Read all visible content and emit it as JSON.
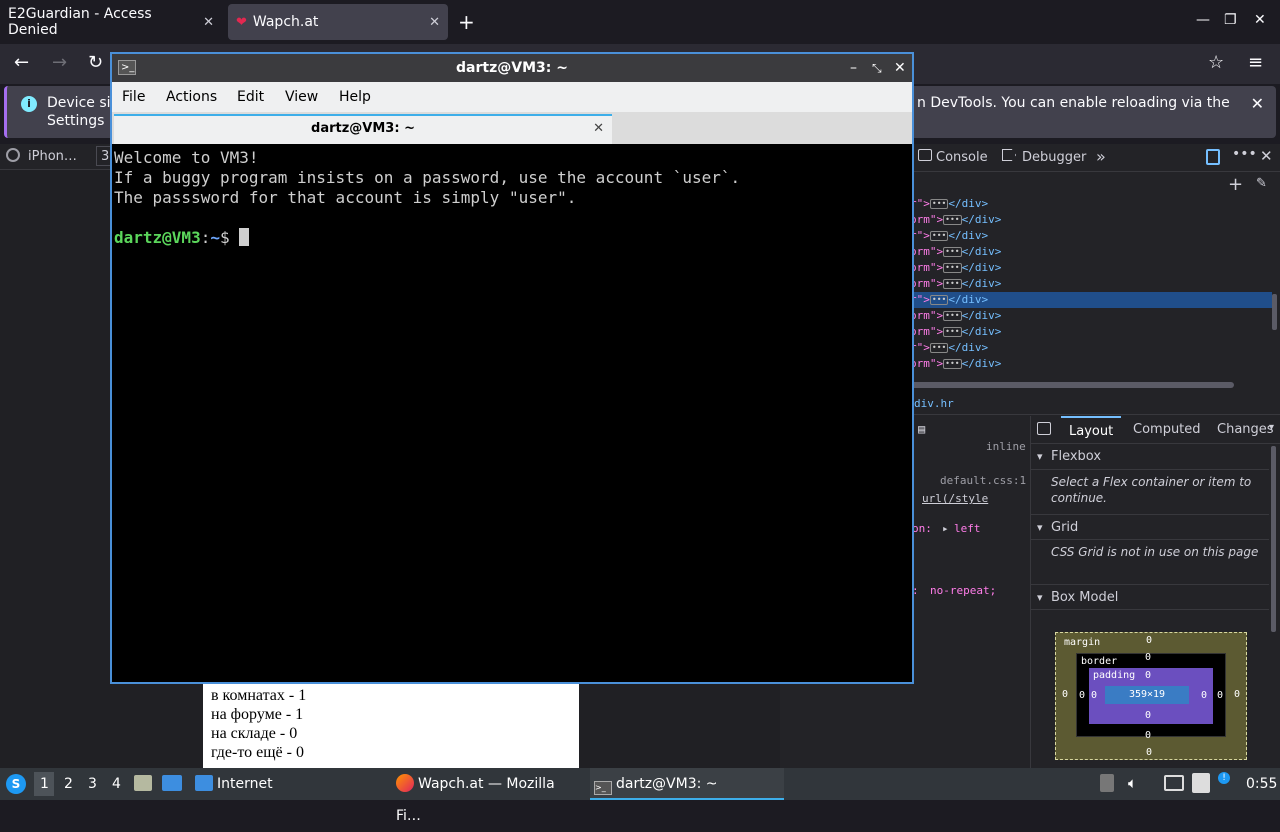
{
  "browser": {
    "tabs": [
      {
        "title": "E2Guardian - Access Denied",
        "close": "✕"
      },
      {
        "title": "Wapch.at",
        "close": "✕"
      }
    ],
    "new_tab": "+",
    "window_controls": {
      "minimize": "—",
      "maximize": "❐",
      "close": "✕"
    },
    "nav": {
      "back": "←",
      "forward": "→",
      "reload": "↻",
      "bookmark": "☆",
      "menu": "≡"
    }
  },
  "infobar": {
    "line1_left": "Device sir",
    "line2_left": "Settings n",
    "line1_right": "n DevTools. You can enable reloading via the",
    "close": "✕"
  },
  "rdm": {
    "device": "iPhon…",
    "width_prefix": "3"
  },
  "page": {
    "lines": [
      "в комнатах - 1",
      "на форуме - 1",
      "на складе - 0",
      "где-то ещё - 0"
    ]
  },
  "devtools": {
    "tabs": {
      "console": "Console",
      "debugger": "Debugger",
      "more": "»"
    },
    "markup": [
      {
        "attr": "r\">",
        "close": "</div>"
      },
      {
        "attr": "orm\">",
        "close": "</div>"
      },
      {
        "attr": "r\">",
        "close": "</div>"
      },
      {
        "attr": "orm\">",
        "close": "</div>"
      },
      {
        "attr": "orm\">",
        "close": "</div>"
      },
      {
        "attr": "orm\">",
        "close": "</div>"
      },
      {
        "attr": "r\">",
        "close": "</div>",
        "selected": true
      },
      {
        "attr": "orm\">",
        "close": "</div>"
      },
      {
        "attr": "orm\">",
        "close": "</div>"
      },
      {
        "attr": "r\">",
        "close": "</div>"
      },
      {
        "attr": "orm\">",
        "close": "</div>"
      }
    ],
    "breadcrumb": "div.hr",
    "rules": {
      "inline": "inline",
      "source": "default.css:1",
      "url": "url(/style",
      "position_prop": "on:",
      "position_val": "left",
      "repeat_prop": ":",
      "repeat_val": "no-repeat;"
    },
    "side_tabs": {
      "layout": "Layout",
      "computed": "Computed",
      "changes": "Changes"
    },
    "flexbox": {
      "title": "Flexbox",
      "text": "Select a Flex container or item to continue."
    },
    "grid": {
      "title": "Grid",
      "text": "CSS Grid is not in use on this page"
    },
    "box_model": {
      "title": "Box Model",
      "margin_label": "margin",
      "border_label": "border",
      "padding_label": "padding",
      "content": "359×19",
      "zero": "0"
    }
  },
  "terminal": {
    "title": "dartz@VM3: ~",
    "menu": [
      "File",
      "Actions",
      "Edit",
      "View",
      "Help"
    ],
    "tab_title": "dartz@VM3: ~",
    "tab_close": "✕",
    "output": [
      "Welcome to VM3!",
      "If a buggy program insists on a password, use the account `user`.",
      "The passsword for that account is simply \"user\"."
    ],
    "prompt_user": "dartz@VM3",
    "prompt_sep": ":",
    "prompt_path": "~",
    "prompt_symbol": "$ "
  },
  "taskbar": {
    "workspaces": [
      "1",
      "2",
      "3",
      "4"
    ],
    "internet": "Internet",
    "tasks": [
      {
        "label": "Wapch.at — Mozilla Fi…"
      },
      {
        "label": "dartz@VM3: ~"
      }
    ],
    "clock": "0:55"
  }
}
